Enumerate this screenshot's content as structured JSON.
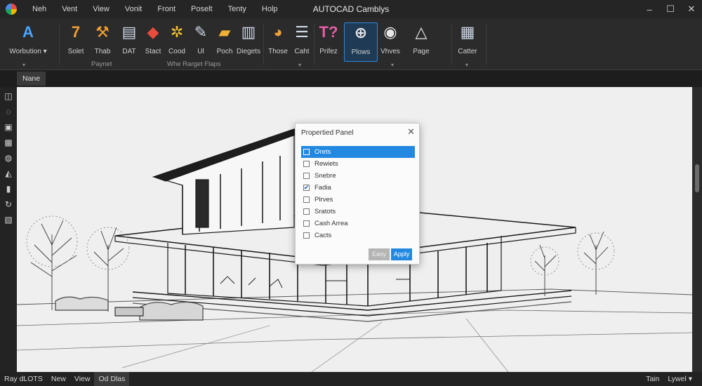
{
  "titlebar": {
    "title": "AUTOCAD Camblys",
    "menu": [
      "Neh",
      "Vent",
      "View",
      "Vonit",
      "Front",
      "Poselt",
      "Tenty",
      "Holp"
    ],
    "controls": [
      "–",
      "☐",
      "✕"
    ]
  },
  "ribbon": {
    "tools": [
      {
        "label": "Worbution ▾",
        "icon": "autocad-a-icon",
        "glyph": "A",
        "color": "#4aa3ff"
      },
      {
        "label": "Solet",
        "icon": "selection-icon",
        "glyph": "7",
        "color": "#f2a134"
      },
      {
        "label": "Thab",
        "icon": "wrench-icon",
        "glyph": "⚒",
        "color": "#f2a134"
      },
      {
        "label": "DAT",
        "icon": "document-icon",
        "glyph": "▤",
        "color": "#cfd8e8"
      },
      {
        "label": "Stact",
        "icon": "palette-icon",
        "glyph": "◆",
        "color": "#e94b3c"
      },
      {
        "label": "Cood",
        "icon": "gear-icon",
        "glyph": "✲",
        "color": "#f2c134"
      },
      {
        "label": "Ul",
        "icon": "brush-icon",
        "glyph": "✎",
        "color": "#cfd8e8"
      },
      {
        "label": "Poch",
        "icon": "ruler-icon",
        "glyph": "▰",
        "color": "#f2b134"
      },
      {
        "label": "Diegets",
        "icon": "binder-icon",
        "glyph": "▥",
        "color": "#cfd8e8"
      },
      {
        "label": "Those",
        "icon": "color-wheel-icon",
        "glyph": "◕",
        "color": "#f2a134"
      },
      {
        "label": "Caht",
        "icon": "list-icon",
        "glyph": "☰",
        "color": "#cfd8e8"
      },
      {
        "label": "Prifez",
        "icon": "text-tool-icon",
        "glyph": "T?",
        "color": "#e85ca8"
      },
      {
        "label": "Plows",
        "icon": "window-grid-icon",
        "glyph": "⊕",
        "color": "#e8e8e8"
      },
      {
        "label": "Vhves",
        "icon": "eye-icon",
        "glyph": "◉",
        "color": "#e8e8e8"
      },
      {
        "label": "Page",
        "icon": "triangle-icon",
        "glyph": "△",
        "color": "#e8e8e8"
      },
      {
        "label": "Catter",
        "icon": "layers-icon",
        "glyph": "▦",
        "color": "#cfd8e8"
      }
    ],
    "group_labels": [
      "Paynet",
      "Whe Rarget Flaps"
    ],
    "active_tool": "Plows"
  },
  "document": {
    "tab": "Nane"
  },
  "left_toolbar": {
    "icons": [
      "line-tool-icon",
      "circle-tool-icon",
      "rectangle-tool-icon",
      "stamp-tool-icon",
      "curve-tool-icon",
      "arrow-tool-icon",
      "pin-tool-icon",
      "rotate-tool-icon",
      "hatch-tool-icon"
    ],
    "glyphs": [
      "◫",
      "◌",
      "▣",
      "▩",
      "◍",
      "◭",
      "▮",
      "↻",
      "▧"
    ]
  },
  "dialog": {
    "title": "Propertied Panel",
    "items": [
      {
        "label": "Orets",
        "checked": false,
        "selected": true
      },
      {
        "label": "Rewiets",
        "checked": false,
        "selected": false
      },
      {
        "label": "Snebre",
        "checked": false,
        "selected": false
      },
      {
        "label": "Fadia",
        "checked": true,
        "selected": false
      },
      {
        "label": "Plrves",
        "checked": false,
        "selected": false
      },
      {
        "label": "Sratots",
        "checked": false,
        "selected": false
      },
      {
        "label": "Cash Arrea",
        "checked": false,
        "selected": false
      },
      {
        "label": "Cacts",
        "checked": false,
        "selected": false
      }
    ],
    "cancel_label": "Easy",
    "apply_label": "Apply",
    "accent": "#2389e0"
  },
  "statusbar": {
    "left": [
      "Ray dLOTS",
      "New",
      "View",
      "Od Dlas"
    ],
    "active": "Od Dlas",
    "right": [
      "Tain",
      "Lywel ▾"
    ]
  }
}
